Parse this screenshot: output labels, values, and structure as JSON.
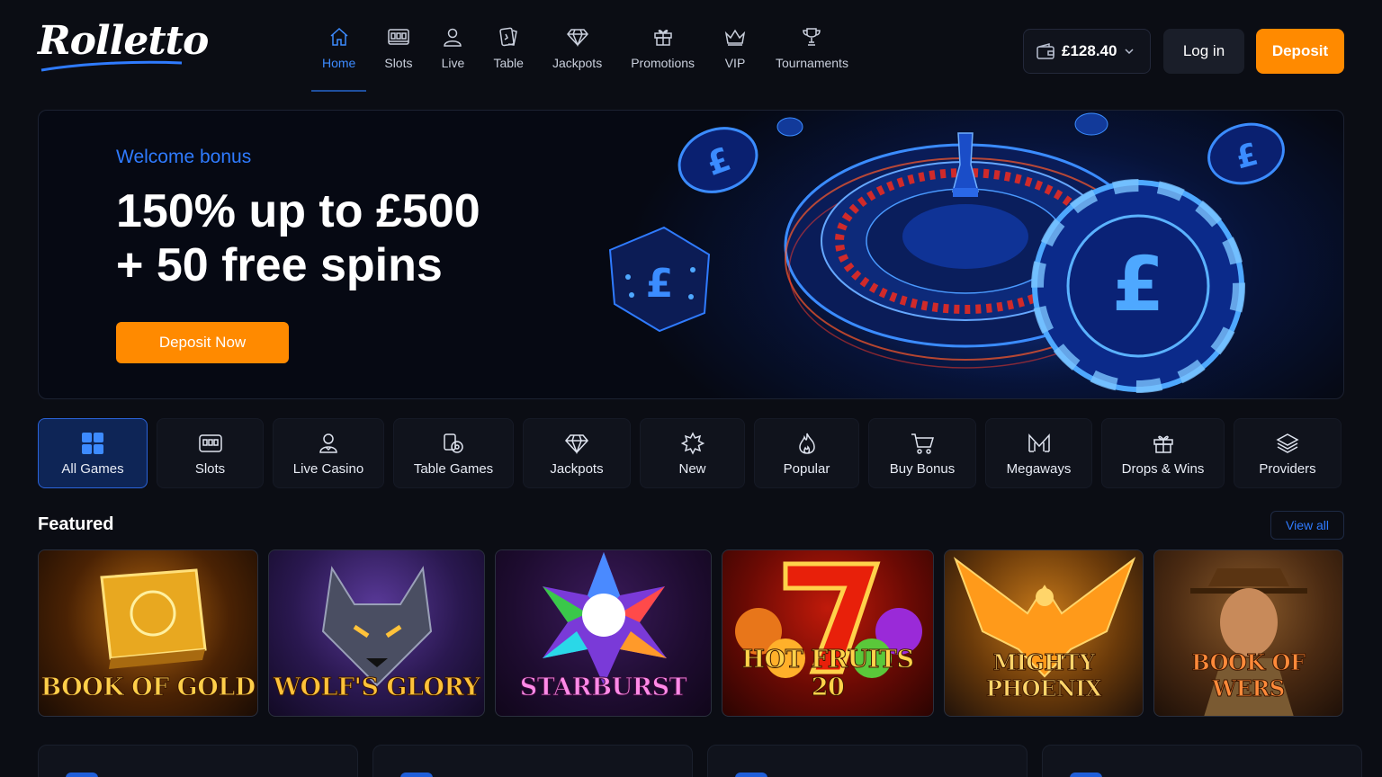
{
  "brand": {
    "logo_text": "Rolletto"
  },
  "nav": {
    "items": [
      {
        "label": "Home",
        "icon": "home-icon",
        "active": true
      },
      {
        "label": "Slots",
        "icon": "slot-machine-icon"
      },
      {
        "label": "Live",
        "icon": "user-icon"
      },
      {
        "label": "Table",
        "icon": "cards-icon"
      },
      {
        "label": "Jackpots",
        "icon": "diamond-icon"
      },
      {
        "label": "Promotions",
        "icon": "gift-icon"
      },
      {
        "label": "VIP",
        "icon": "crown-icon"
      },
      {
        "label": "Tournaments",
        "icon": "trophy-icon"
      }
    ]
  },
  "account": {
    "balance": "£128.40",
    "login_label": "Log in",
    "deposit_label": "Deposit"
  },
  "hero": {
    "eyebrow": "Welcome bonus",
    "title_line1": "150% up to £500",
    "title_line2": "+ 50 free spins",
    "cta_label": "Deposit Now"
  },
  "categories": [
    {
      "label": "All Games",
      "icon": "grid-icon",
      "active": true
    },
    {
      "label": "Slots",
      "icon": "slot-machine-icon"
    },
    {
      "label": "Live Casino",
      "icon": "dealer-icon"
    },
    {
      "label": "Table Games",
      "icon": "chip-cards-icon"
    },
    {
      "label": "Jackpots",
      "icon": "diamond-icon"
    },
    {
      "label": "New",
      "icon": "star-burst-icon"
    },
    {
      "label": "Popular",
      "icon": "flame-icon"
    },
    {
      "label": "Buy Bonus",
      "icon": "cart-icon"
    },
    {
      "label": "Megaways",
      "icon": "megaways-icon"
    },
    {
      "label": "Drops & Wins",
      "icon": "gift-icon"
    },
    {
      "label": "Providers",
      "icon": "layers-icon"
    }
  ],
  "featured": {
    "title": "Featured",
    "view_all_label": "View all",
    "games": [
      {
        "name": "BOOK OF GOLD",
        "name_main": "BOOK",
        "name_of": "OF",
        "name_end": "GOLD"
      },
      {
        "name": "WOLF'S GLORY"
      },
      {
        "name": "STARBURST"
      },
      {
        "name": "HOT FRUITS 20"
      },
      {
        "name": "MIGHTY PHOENIX"
      },
      {
        "name": "BOOK OF WERS"
      }
    ]
  },
  "colors": {
    "background": "#0b0d14",
    "accent_blue": "#2f7bff",
    "accent_orange": "#ff8a00",
    "active_tile": "#0e2556"
  }
}
